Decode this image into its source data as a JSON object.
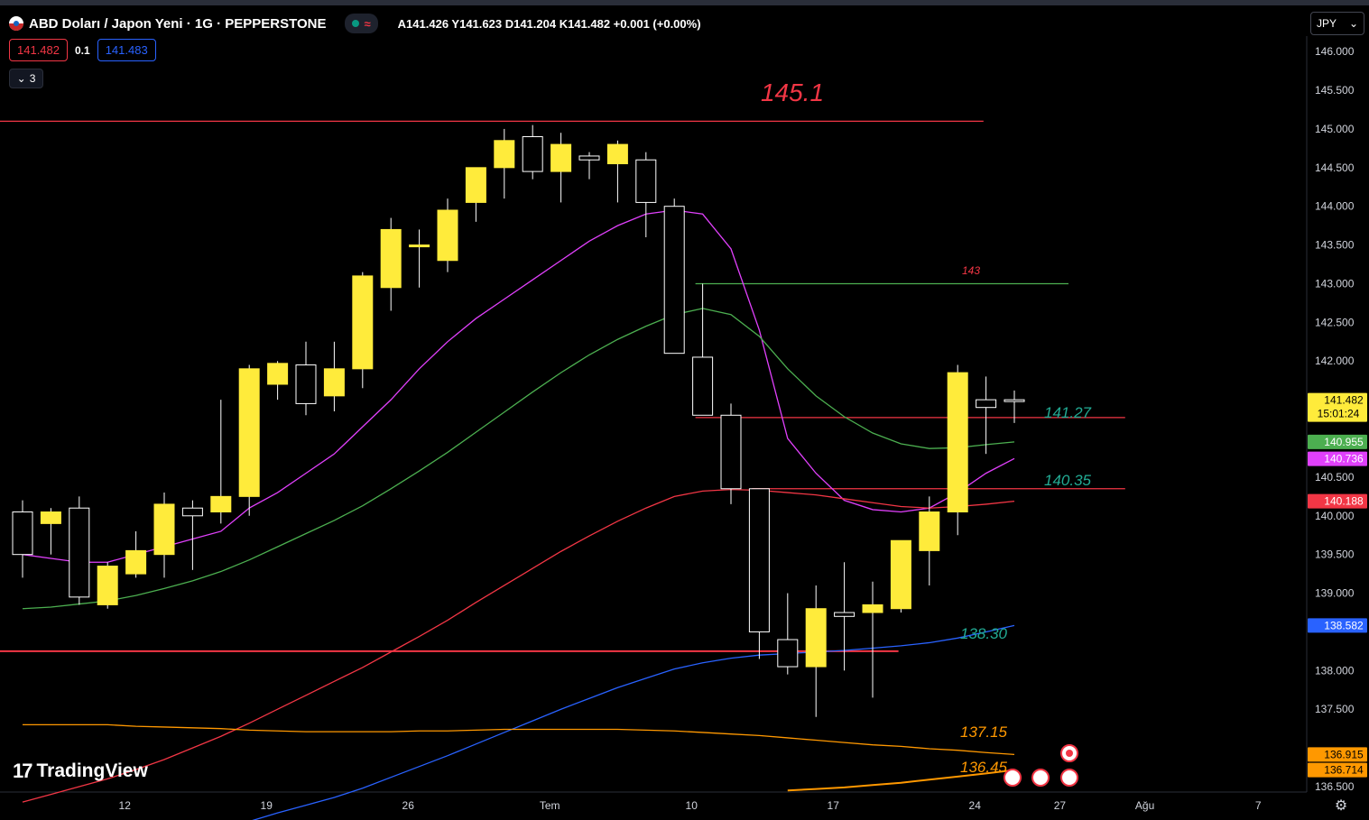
{
  "header": {
    "symbol_title": "ABD Doları / Japon Yeni · 1G · PEPPERSTONE",
    "status_wave": "≈",
    "ohlc": "A141.426  Y141.623  D141.204  K141.482  +0.001 (+0.00%)"
  },
  "trade": {
    "sell_price": "141.482",
    "spread": "0.1",
    "buy_price": "141.483"
  },
  "indicators_toggle": {
    "count": "3"
  },
  "currency_select": {
    "value": "JPY",
    "chevron": "⌄"
  },
  "logo": {
    "mark": "17",
    "text": "TradingView"
  },
  "settings_icon": "⚙",
  "colors": {
    "candle_up": "#ffeb3b",
    "candle_down": "#000000",
    "wick": "#ffffff",
    "ma_fast": "#e040fb",
    "ma_mid": "#4caf50",
    "ma_50": "#f23645",
    "ma_100": "#2962ff",
    "ma_200": "#ff9800",
    "hline": "#f23645",
    "annot": "#22ab94"
  },
  "chart_data": {
    "type": "candlestick",
    "y_axis_ticks": [
      "146.000",
      "145.500",
      "145.000",
      "144.500",
      "144.000",
      "143.500",
      "143.000",
      "142.500",
      "142.000",
      "140.500",
      "140.000",
      "139.500",
      "139.000",
      "138.000",
      "137.500",
      "136.500"
    ],
    "x_axis_ticks": [
      "12",
      "19",
      "26",
      "Tem",
      "10",
      "17",
      "24",
      "27",
      "Ağu",
      "7"
    ],
    "ylim": [
      136.43,
      146.2
    ],
    "candles": [
      {
        "o": 140.05,
        "h": 140.2,
        "c": 139.5,
        "l": 139.2
      },
      {
        "o": 139.9,
        "h": 140.1,
        "c": 140.05,
        "l": 139.5
      },
      {
        "o": 140.1,
        "h": 140.25,
        "c": 138.95,
        "l": 138.85
      },
      {
        "o": 138.85,
        "h": 139.4,
        "c": 139.35,
        "l": 138.8
      },
      {
        "o": 139.25,
        "h": 139.8,
        "c": 139.55,
        "l": 139.2
      },
      {
        "o": 139.5,
        "h": 140.3,
        "c": 140.15,
        "l": 139.2
      },
      {
        "o": 140.1,
        "h": 140.2,
        "c": 140.0,
        "l": 139.3
      },
      {
        "o": 140.05,
        "h": 141.5,
        "c": 140.25,
        "l": 139.9
      },
      {
        "o": 140.25,
        "h": 141.95,
        "c": 141.9,
        "l": 140.0
      },
      {
        "o": 141.7,
        "h": 142.0,
        "c": 141.97,
        "l": 141.5
      },
      {
        "o": 141.95,
        "h": 142.25,
        "c": 141.45,
        "l": 141.3
      },
      {
        "o": 141.55,
        "h": 142.25,
        "c": 141.9,
        "l": 141.35
      },
      {
        "o": 141.9,
        "h": 143.15,
        "c": 143.1,
        "l": 141.65
      },
      {
        "o": 142.95,
        "h": 143.85,
        "c": 143.7,
        "l": 142.65
      },
      {
        "o": 143.48,
        "h": 143.7,
        "c": 143.5,
        "l": 142.95
      },
      {
        "o": 143.3,
        "h": 144.1,
        "c": 143.95,
        "l": 143.15
      },
      {
        "o": 144.05,
        "h": 144.5,
        "c": 144.5,
        "l": 143.8
      },
      {
        "o": 144.5,
        "h": 145.0,
        "c": 144.85,
        "l": 144.1
      },
      {
        "o": 144.9,
        "h": 145.05,
        "c": 144.45,
        "l": 144.35
      },
      {
        "o": 144.45,
        "h": 144.95,
        "c": 144.8,
        "l": 144.05
      },
      {
        "o": 144.65,
        "h": 144.7,
        "c": 144.6,
        "l": 144.35
      },
      {
        "o": 144.55,
        "h": 144.85,
        "c": 144.8,
        "l": 144.05
      },
      {
        "o": 144.6,
        "h": 144.7,
        "c": 144.05,
        "l": 143.6
      },
      {
        "o": 144.0,
        "h": 144.1,
        "c": 142.1,
        "l": 142.1
      },
      {
        "o": 142.05,
        "h": 143.0,
        "c": 141.3,
        "l": 141.3
      },
      {
        "o": 141.3,
        "h": 141.45,
        "c": 140.35,
        "l": 140.15
      },
      {
        "o": 140.35,
        "h": 140.35,
        "c": 138.5,
        "l": 138.15
      },
      {
        "o": 138.4,
        "h": 139.0,
        "c": 138.05,
        "l": 137.95
      },
      {
        "o": 138.05,
        "h": 139.1,
        "c": 138.8,
        "l": 137.4
      },
      {
        "o": 138.75,
        "h": 139.4,
        "c": 138.7,
        "l": 138.0
      },
      {
        "o": 138.75,
        "h": 139.15,
        "c": 138.85,
        "l": 137.65
      },
      {
        "o": 138.8,
        "h": 139.65,
        "c": 139.68,
        "l": 138.75
      },
      {
        "o": 139.55,
        "h": 140.25,
        "c": 140.05,
        "l": 139.1
      },
      {
        "o": 140.05,
        "h": 141.95,
        "c": 141.85,
        "l": 139.75
      },
      {
        "o": 141.5,
        "h": 141.8,
        "c": 141.4,
        "l": 140.8
      },
      {
        "o": 141.5,
        "h": 141.62,
        "c": 141.482,
        "l": 141.2
      }
    ],
    "series": [
      {
        "name": "MA fast",
        "values": [
          139.5,
          139.45,
          139.4,
          139.4,
          139.5,
          139.6,
          139.7,
          139.8,
          140.1,
          140.3,
          140.55,
          140.8,
          141.15,
          141.5,
          141.9,
          142.25,
          142.55,
          142.8,
          143.05,
          143.3,
          143.55,
          143.75,
          143.9,
          143.95,
          143.9,
          143.45,
          142.4,
          141.0,
          140.55,
          140.2,
          140.08,
          140.05,
          140.1,
          140.3,
          140.55,
          140.74
        ]
      },
      {
        "name": "MA mid",
        "values": [
          138.8,
          138.82,
          138.86,
          138.9,
          138.97,
          139.06,
          139.16,
          139.28,
          139.43,
          139.6,
          139.77,
          139.94,
          140.13,
          140.35,
          140.58,
          140.82,
          141.08,
          141.34,
          141.6,
          141.85,
          142.08,
          142.28,
          142.45,
          142.6,
          142.68,
          142.6,
          142.32,
          141.9,
          141.55,
          141.28,
          141.07,
          140.93,
          140.87,
          140.88,
          140.92,
          140.955
        ]
      },
      {
        "name": "MA 50",
        "values": [
          136.3,
          136.4,
          136.5,
          136.6,
          136.72,
          136.85,
          137.0,
          137.15,
          137.32,
          137.5,
          137.68,
          137.86,
          138.04,
          138.24,
          138.44,
          138.65,
          138.88,
          139.1,
          139.32,
          139.54,
          139.74,
          139.93,
          140.1,
          140.25,
          140.32,
          140.34,
          140.33,
          140.3,
          140.27,
          140.22,
          140.17,
          140.12,
          140.1,
          140.12,
          140.15,
          140.188
        ]
      },
      {
        "name": "MA 100",
        "values": [
          null,
          null,
          null,
          null,
          null,
          null,
          null,
          null,
          136.05,
          136.16,
          136.26,
          136.36,
          136.48,
          136.62,
          136.76,
          136.9,
          137.05,
          137.2,
          137.35,
          137.5,
          137.64,
          137.78,
          137.9,
          138.02,
          138.1,
          138.16,
          138.2,
          138.22,
          138.24,
          138.26,
          138.29,
          138.32,
          138.36,
          138.42,
          138.5,
          138.582
        ]
      },
      {
        "name": "MA 200",
        "values": [
          137.3,
          137.3,
          137.3,
          137.3,
          137.28,
          137.27,
          137.26,
          137.25,
          137.23,
          137.22,
          137.21,
          137.21,
          137.21,
          137.21,
          137.22,
          137.22,
          137.23,
          137.24,
          137.24,
          137.24,
          137.24,
          137.24,
          137.23,
          137.22,
          137.2,
          137.18,
          137.16,
          137.13,
          137.1,
          137.07,
          137.04,
          137.02,
          136.99,
          136.97,
          136.94,
          136.915
        ]
      },
      {
        "name": "MA 300",
        "values": [
          null,
          null,
          null,
          null,
          null,
          null,
          null,
          null,
          null,
          null,
          null,
          null,
          null,
          null,
          null,
          null,
          null,
          null,
          null,
          null,
          null,
          null,
          null,
          null,
          null,
          null,
          null,
          136.45,
          136.47,
          136.49,
          136.52,
          136.55,
          136.59,
          136.63,
          136.67,
          136.714
        ]
      }
    ],
    "hlines": [
      {
        "label": "145.1",
        "value": 145.1,
        "end_index": 32
      },
      {
        "label": "143",
        "value": 143.0,
        "start_index": 24,
        "end_index": 35
      },
      {
        "label": "141.27",
        "value": 141.27,
        "start_index": 24,
        "end_index": 37
      },
      {
        "label": "140.35",
        "value": 140.35,
        "start_index": 26,
        "end_index": 37
      },
      {
        "label": "",
        "value": 138.25,
        "end_index": 29
      },
      {
        "label": "138.30",
        "value": 138.3,
        "start_index": 28,
        "end_index": 33,
        "invisible_line": true
      },
      {
        "label": "137.15",
        "value": 137.15,
        "start_index": 30,
        "end_index": 33,
        "invisible_line": true
      },
      {
        "label": "136.45",
        "value": 136.45,
        "start_index": 30,
        "end_index": 33,
        "invisible_line": true
      }
    ],
    "price_tags": [
      {
        "value": "141.482",
        "sub": "15:01:24",
        "bg": "#ffeb3b",
        "fg": "#000000",
        "at": 141.482
      },
      {
        "value": "140.955",
        "bg": "#4caf50",
        "fg": "#ffffff",
        "at": 140.955
      },
      {
        "value": "140.736",
        "bg": "#e040fb",
        "fg": "#ffffff",
        "at": 140.736
      },
      {
        "value": "140.188",
        "bg": "#f23645",
        "fg": "#ffffff",
        "at": 140.188
      },
      {
        "value": "138.582",
        "bg": "#2962ff",
        "fg": "#ffffff",
        "at": 138.582
      },
      {
        "value": "136.915",
        "bg": "#ff9800",
        "fg": "#000000",
        "at": 136.915
      },
      {
        "value": "136.714",
        "bg": "#ff9800",
        "fg": "#000000",
        "at": 136.714
      }
    ]
  }
}
